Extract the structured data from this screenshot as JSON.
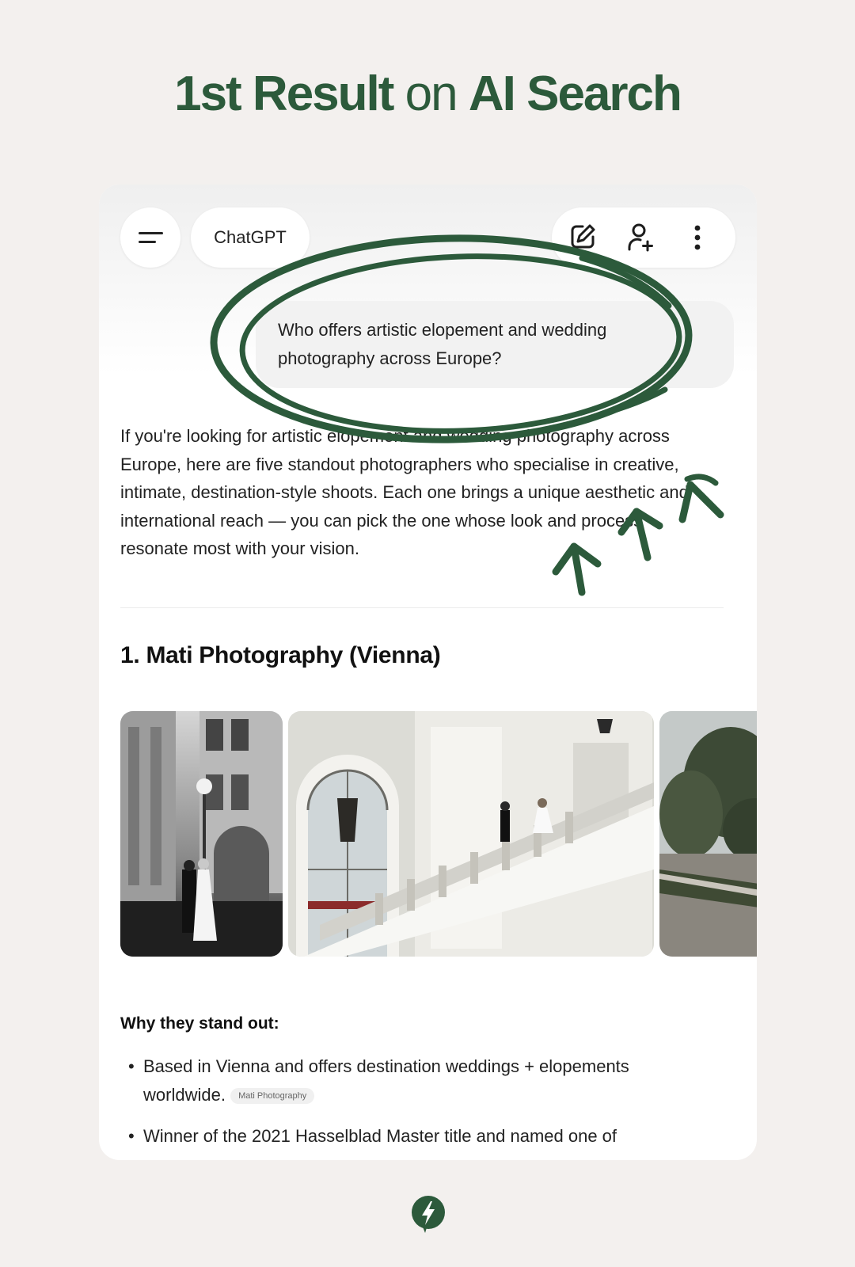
{
  "headline": {
    "bold1": "1st Result",
    "middle": "on",
    "bold2": "AI Search"
  },
  "app": {
    "name": "ChatGPT"
  },
  "toolbar": {
    "menu_icon": "menu-icon",
    "new_chat_icon": "edit-icon",
    "add_person_icon": "add-user-icon",
    "more_icon": "more-vertical-icon"
  },
  "prompt": {
    "line1": "Who offers artistic elopement and wedding",
    "line2": "photography across Europe?"
  },
  "answer": {
    "line1": "If you're looking for artistic elopement and wedding photography across",
    "line2": "Europe, here are five standout photographers who specialise in creative,",
    "line3": "intimate, destination-style shoots. Each one brings a unique aesthetic and",
    "line4": "international reach — you can pick the one whose look and process",
    "line5": "resonate most with your vision."
  },
  "result": {
    "title": "1. Mati Photography (Vienna)",
    "why_heading": "Why they stand out:",
    "bullets": [
      {
        "text1": "Based in Vienna and offers destination weddings + elopements",
        "text2": "worldwide.",
        "citation": "Mati Photography"
      },
      {
        "text1": "Winner of the 2021 Hasselblad Master title and named one of"
      }
    ]
  },
  "colors": {
    "brand_green": "#2c5a3b",
    "background": "#f3f0ee",
    "card": "#ffffff"
  },
  "footer": {
    "logo_icon": "lightning-bolt-icon"
  }
}
